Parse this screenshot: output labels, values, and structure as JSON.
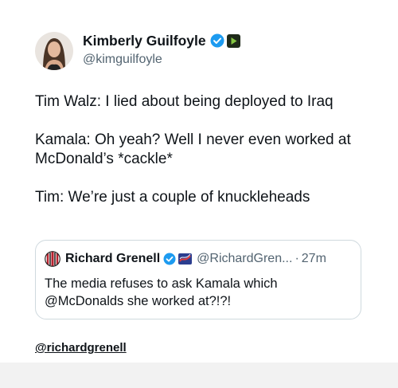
{
  "author": {
    "display_name": "Kimberly Guilfoyle",
    "handle": "@kimguilfoyle",
    "verified_icon": "verified-badge-icon",
    "affiliate_icon": "rumble-logo-icon",
    "verified_color": "#1d9bf0"
  },
  "tweet": {
    "lines": [
      "Tim Walz: I lied about being deployed to Iraq",
      "Kamala: Oh yeah? Well I never even worked at",
      "McDonald’s *cackle*",
      "Tim: We’re just a couple of knuckleheads"
    ]
  },
  "quote": {
    "display_name": "Richard Grenell",
    "handle": "@RichardGren...",
    "separator": "·",
    "time": "27m",
    "text_lines": [
      "The media refuses to ask Kamala which",
      "@McDonalds she worked at?!?!"
    ]
  },
  "credit": "@richardgrenell"
}
